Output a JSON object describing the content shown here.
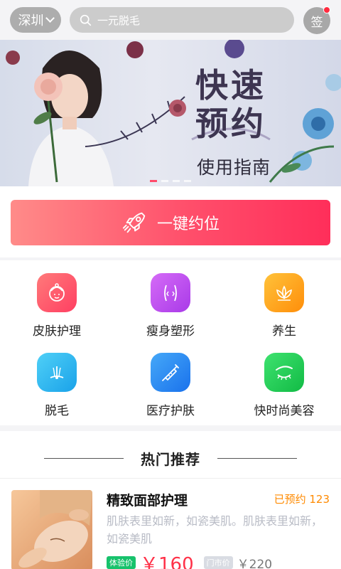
{
  "header": {
    "city": "深圳",
    "search_placeholder": "一元脱毛",
    "sign_label": "签"
  },
  "banner": {
    "title_line1": "快速",
    "title_line2": "预约",
    "subtitle": "使用指南"
  },
  "booking": {
    "label": "一键约位"
  },
  "categories": [
    {
      "label": "皮肤护理",
      "icon": "skin-care-icon",
      "color": "#ff4f6b"
    },
    {
      "label": "瘦身塑形",
      "icon": "body-shaping-icon",
      "color": "#c64cf0"
    },
    {
      "label": "养生",
      "icon": "lotus-icon",
      "color": "#ffa10e"
    },
    {
      "label": "脱毛",
      "icon": "hair-removal-icon",
      "color": "#27b4f0"
    },
    {
      "label": "医疗护肤",
      "icon": "syringe-icon",
      "color": "#2b8df5"
    },
    {
      "label": "快时尚美容",
      "icon": "eyebrow-icon",
      "color": "#18c956"
    }
  ],
  "hot": {
    "title": "热门推荐"
  },
  "product": {
    "name": "精致面部护理",
    "booked": "已预约 123",
    "desc": "肌肤表里如新，如瓷美肌。肌肤表里如新，如瓷美肌",
    "tag_exp": "体验价",
    "price": "￥160",
    "tag_market": "门市价",
    "market_price": "￥220"
  },
  "colors": {
    "accent": "#ff3e5f",
    "orange": "#ff8a00"
  }
}
